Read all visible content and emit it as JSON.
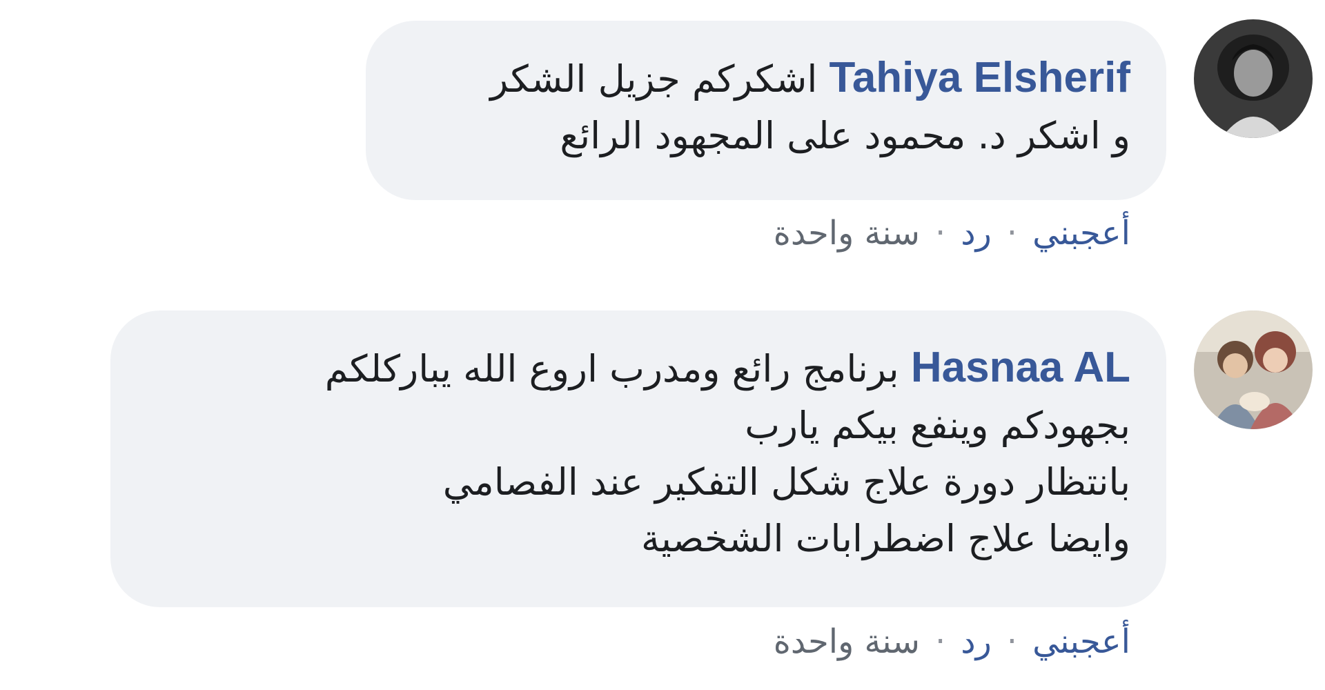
{
  "comments": [
    {
      "author": "Tahiya Elsherif",
      "lines": [
        "اشكركم جزيل الشكر",
        "و اشكر د. محمود على المجهود الرائع"
      ],
      "actions": {
        "like": "أعجبني",
        "separator": "·",
        "reply": "رد",
        "time": "سنة واحدة"
      }
    },
    {
      "author": "Hasnaa AL",
      "lines": [
        "برنامج رائع ومدرب اروع الله يباركلكم",
        "بجهودكم وينفع بيكم يارب",
        "بانتظار دورة علاج شكل التفكير عند الفصامي",
        "وايضا علاج اضطرابات الشخصية"
      ],
      "actions": {
        "like": "أعجبني",
        "separator": "·",
        "reply": "رد",
        "time": "سنة واحدة"
      }
    }
  ]
}
